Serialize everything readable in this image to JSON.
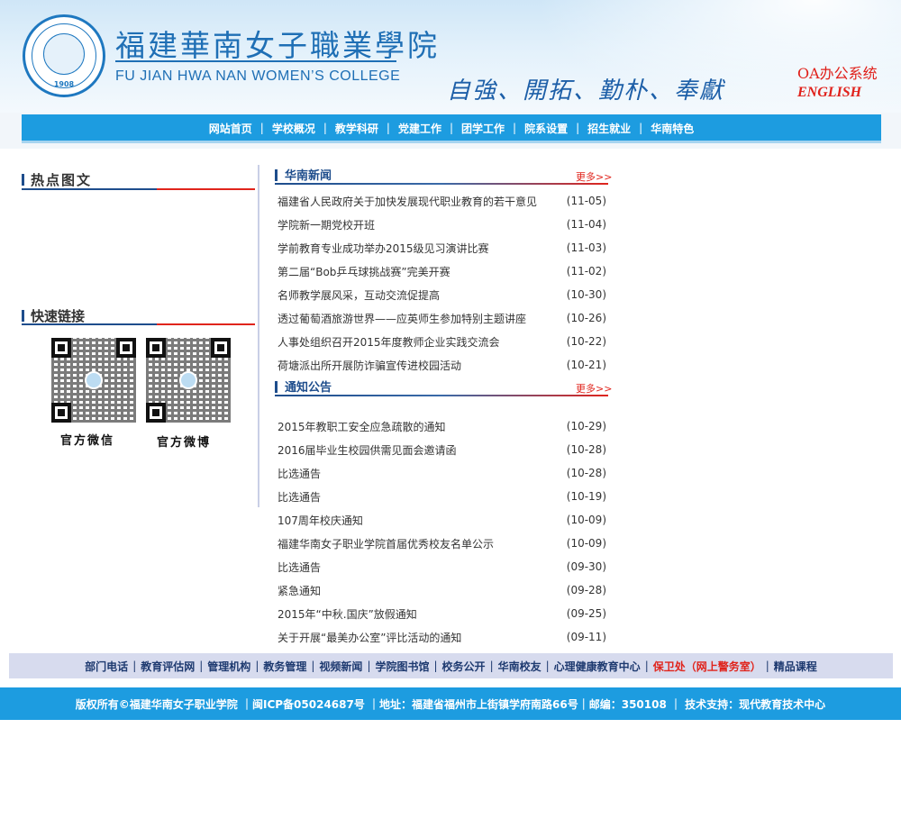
{
  "header": {
    "seal_year": "1908",
    "college_name_cn": "福建華南女子職業學院",
    "college_name_en": "FU JIAN HWA NAN WOMEN’S COLLEGE",
    "motto": "自強、開拓、勤朴、奉獻",
    "oa_label": "OA办公系统",
    "english_label": "ENGLISH"
  },
  "nav": {
    "items": [
      "网站首页",
      "学校概况",
      "教学科研",
      "党建工作",
      "团学工作",
      "院系设置",
      "招生就业",
      "华南特色"
    ],
    "separator": "|"
  },
  "sidebar": {
    "hot_title": "热点图文",
    "links_title": "快速链接",
    "qr_labels": [
      "官方微信",
      "官方微博"
    ]
  },
  "news": {
    "title": "华南新闻",
    "more_label": "更多>>",
    "items": [
      {
        "title": "福建省人民政府关于加快发展现代职业教育的若干意见",
        "date": "(11-05)"
      },
      {
        "title": "学院新一期党校开班",
        "date": "(11-04)"
      },
      {
        "title": "学前教育专业成功举办2015级见习演讲比赛",
        "date": "(11-03)"
      },
      {
        "title": "第二届“Bob乒乓球挑战赛”完美开赛",
        "date": "(11-02)"
      },
      {
        "title": "名师教学展风采，互动交流促提高",
        "date": "(10-30)"
      },
      {
        "title": "透过葡萄酒旅游世界——应英师生参加特别主题讲座",
        "date": "(10-26)"
      },
      {
        "title": "人事处组织召开2015年度教师企业实践交流会",
        "date": "(10-22)"
      },
      {
        "title": "荷塘派出所开展防诈骗宣传进校园活动",
        "date": "(10-21)"
      }
    ]
  },
  "notices": {
    "title": "通知公告",
    "more_label": "更多>>",
    "items": [
      {
        "title": "2015年教职工安全应急疏散的通知",
        "date": "(10-29)"
      },
      {
        "title": "2016届毕业生校园供需见面会邀请函",
        "date": "(10-28)"
      },
      {
        "title": "比选通告",
        "date": "(10-28)"
      },
      {
        "title": "比选通告",
        "date": "(10-19)"
      },
      {
        "title": "107周年校庆通知",
        "date": "(10-09)"
      },
      {
        "title": "福建华南女子职业学院首届优秀校友名单公示",
        "date": "(10-09)"
      },
      {
        "title": "比选通告",
        "date": "(09-30)"
      },
      {
        "title": "紧急通知",
        "date": "(09-28)"
      },
      {
        "title": "2015年“中秋.国庆”放假通知",
        "date": "(09-25)"
      },
      {
        "title": "关于开展“最美办公室”评比活动的通知",
        "date": "(09-11)"
      }
    ]
  },
  "bottom_links": {
    "items": [
      "部门电话",
      "教育评估网",
      "管理机构",
      "教务管理",
      "视频新闻",
      "学院图书馆",
      "校务公开",
      "华南校友",
      "心理健康教育中心",
      "保卫处（网上警务室）",
      "精品课程"
    ],
    "highlight_color": "#e0241c"
  },
  "footer": {
    "text": "版权所有©福建华南女子职业学院 ｜闽ICP备05024687号 ｜地址：福建省福州市上街镇学府南路66号｜邮编：350108 ｜ 技术支持：现代教育技术中心"
  },
  "colors": {
    "nav_blue": "#1d9ce0",
    "title_blue": "#1e4d8c",
    "accent_red": "#e0241c"
  }
}
